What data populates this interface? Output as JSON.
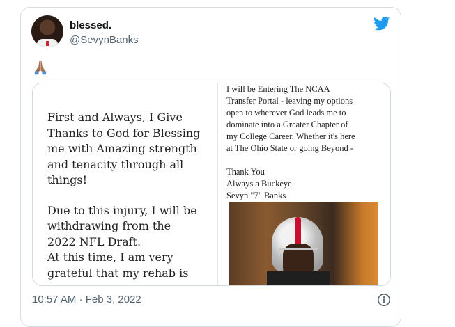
{
  "tweet": {
    "display_name": "blessed.",
    "handle": "@SevynBanks",
    "emoji": "🙏",
    "timestamp": "10:57 AM · Feb 3, 2022"
  },
  "media": {
    "left_lines": [
      "First and Always, I Give",
      "Thanks to God for Blessing",
      "me with Amazing strength",
      "and tenacity through all",
      "things!",
      "Due to this injury, I will be",
      "withdrawing from the",
      "2022 NFL Draft.",
      "At this time, I am very",
      "grateful that my rehab is"
    ],
    "right_lines": [
      "I will be Entering The NCAA",
      "Transfer Portal - leaving my options",
      "open to wherever God leads me to",
      "dominate into a Greater Chapter of",
      "my College Career. Whether it's here",
      "at The Ohio State or going Beyond -",
      "Thank You",
      "Always a Buckeye",
      "Sevyn \"7\" Banks"
    ]
  },
  "colors": {
    "twitter_blue": "#1d9bf0",
    "text_primary": "#0f1419",
    "text_secondary": "#536471"
  },
  "icons": {
    "brand": "twitter-bird-icon",
    "info": "info-icon"
  }
}
